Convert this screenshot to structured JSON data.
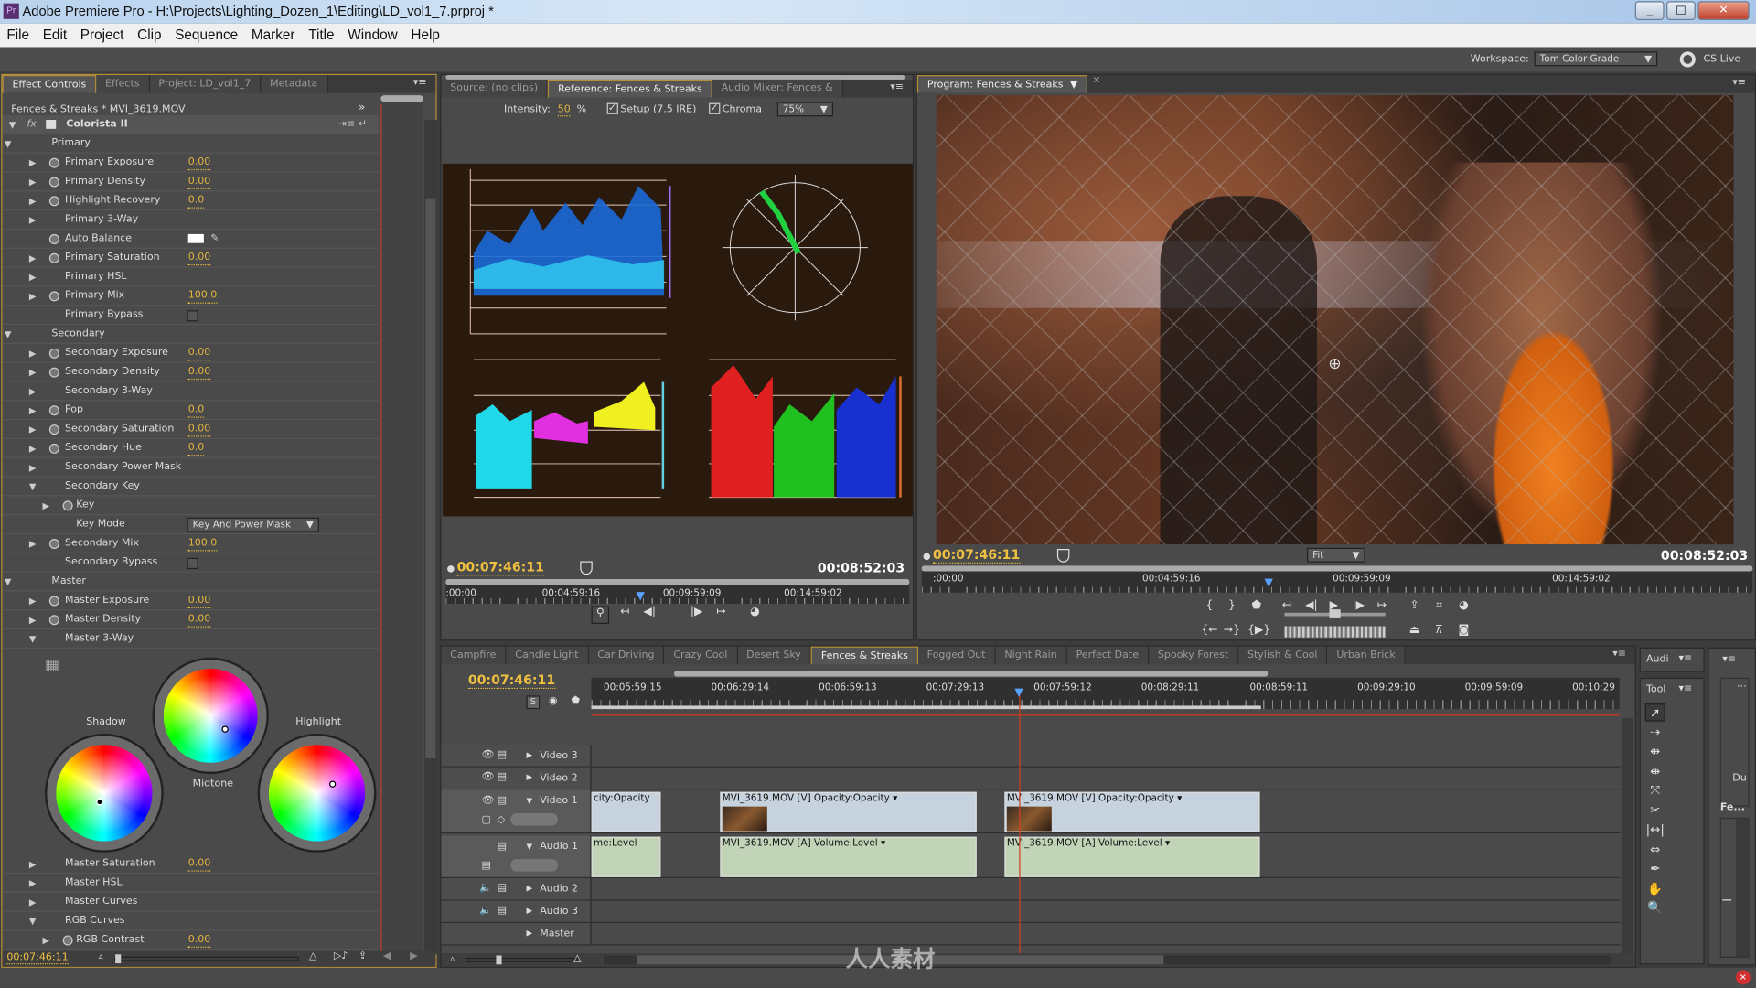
{
  "window": {
    "title": "Adobe Premiere Pro - H:\\Projects\\Lighting_Dozen_1\\Editing\\LD_vol1_7.prproj *",
    "app_icon": "Pr"
  },
  "menu": [
    "File",
    "Edit",
    "Project",
    "Clip",
    "Sequence",
    "Marker",
    "Title",
    "Window",
    "Help"
  ],
  "workspace": {
    "label": "Workspace:",
    "value": "Tom Color Grade",
    "cs_live": "CS Live"
  },
  "effect_controls": {
    "tabs": [
      "Effect Controls",
      "Effects",
      "Project: LD_vol1_7",
      "Metadata"
    ],
    "clip_header": "Fences & Streaks * MVI_3619.MOV",
    "effect_name": "Colorista II",
    "rows_top": [
      {
        "label": "Primary",
        "level": 0,
        "twirl": "open"
      },
      {
        "label": "Primary Exposure",
        "level": 1,
        "twirl": "closed",
        "sw": true,
        "value": "0.00"
      },
      {
        "label": "Primary Density",
        "level": 1,
        "twirl": "closed",
        "sw": true,
        "value": "0.00"
      },
      {
        "label": "Highlight Recovery",
        "level": 1,
        "twirl": "closed",
        "sw": true,
        "value": "0.0"
      },
      {
        "label": "Primary 3-Way",
        "level": 1,
        "twirl": "closed"
      },
      {
        "label": "Auto Balance",
        "level": 1,
        "sw": true,
        "kind": "swatch"
      },
      {
        "label": "Primary Saturation",
        "level": 1,
        "twirl": "closed",
        "sw": true,
        "value": "0.00"
      },
      {
        "label": "Primary HSL",
        "level": 1,
        "twirl": "closed"
      },
      {
        "label": "Primary Mix",
        "level": 1,
        "twirl": "closed",
        "sw": true,
        "value": "100.0"
      },
      {
        "label": "Primary Bypass",
        "level": 1,
        "kind": "checkbox"
      },
      {
        "label": "Secondary",
        "level": 0,
        "twirl": "open"
      },
      {
        "label": "Secondary Exposure",
        "level": 1,
        "twirl": "closed",
        "sw": true,
        "value": "0.00"
      },
      {
        "label": "Secondary Density",
        "level": 1,
        "twirl": "closed",
        "sw": true,
        "value": "0.00"
      },
      {
        "label": "Secondary 3-Way",
        "level": 1,
        "twirl": "closed"
      },
      {
        "label": "Pop",
        "level": 1,
        "twirl": "closed",
        "sw": true,
        "value": "0.0"
      },
      {
        "label": "Secondary Saturation",
        "level": 1,
        "twirl": "closed",
        "sw": true,
        "value": "0.00"
      },
      {
        "label": "Secondary Hue",
        "level": 1,
        "twirl": "closed",
        "sw": true,
        "value": "0.0"
      },
      {
        "label": "Secondary Power Mask",
        "level": 1,
        "twirl": "closed"
      },
      {
        "label": "Secondary Key",
        "level": 1,
        "twirl": "open"
      },
      {
        "label": "Key",
        "level": 2,
        "twirl": "closed",
        "sw": true
      },
      {
        "label": "Key Mode",
        "level": 2,
        "kind": "dropdown",
        "value": "Key And Power Mask"
      },
      {
        "label": "Secondary Mix",
        "level": 1,
        "twirl": "closed",
        "sw": true,
        "value": "100.0"
      },
      {
        "label": "Secondary Bypass",
        "level": 1,
        "kind": "checkbox"
      },
      {
        "label": "Master",
        "level": 0,
        "twirl": "open"
      },
      {
        "label": "Master Exposure",
        "level": 1,
        "twirl": "closed",
        "sw": true,
        "value": "0.00"
      },
      {
        "label": "Master Density",
        "level": 1,
        "twirl": "closed",
        "sw": true,
        "value": "0.00"
      },
      {
        "label": "Master 3-Way",
        "level": 1,
        "twirl": "open"
      }
    ],
    "wheels": {
      "shadow": "Shadow",
      "midtone": "Midtone",
      "highlight": "Highlight"
    },
    "rows_bottom": [
      {
        "label": "Master Saturation",
        "level": 1,
        "twirl": "closed",
        "value": "0.00"
      },
      {
        "label": "Master HSL",
        "level": 1,
        "twirl": "closed"
      },
      {
        "label": "Master Curves",
        "level": 1,
        "twirl": "closed"
      },
      {
        "label": "RGB Curves",
        "level": 1,
        "twirl": "open"
      },
      {
        "label": "RGB Contrast",
        "level": 2,
        "twirl": "closed",
        "sw": true,
        "value": "0.00"
      }
    ],
    "timecode": "00:07:46:11"
  },
  "reference": {
    "tabs": [
      "Source: (no clips)",
      "Reference: Fences & Streaks",
      "Audio Mixer: Fences &"
    ],
    "intensity_label": "Intensity:",
    "intensity": "50",
    "pct": "%",
    "setup_label": "Setup (7.5 IRE)",
    "setup_checked": true,
    "chroma_label": "Chroma",
    "chroma_checked": true,
    "zoom": "75%",
    "timecode": "00:07:46:11",
    "duration": "00:08:52:03",
    "ruler": [
      ":00:00",
      "00:04:59:16",
      "00:09:59:09",
      "00:14:59:02"
    ]
  },
  "program": {
    "tab": "Program: Fences & Streaks",
    "timecode": "00:07:46:11",
    "duration": "00:08:52:03",
    "fit": "Fit",
    "ruler": [
      ":00:00",
      "00:04:59:16",
      "00:09:59:09",
      "00:14:59:02"
    ]
  },
  "timeline": {
    "tabs": [
      "Campfire",
      "Candle Light",
      "Car Driving",
      "Crazy Cool",
      "Desert Sky",
      "Fences & Streaks",
      "Fogged Out",
      "Night Rain",
      "Perfect Date",
      "Spooky Forest",
      "Stylish & Cool",
      "Urban Brick"
    ],
    "active_tab": "Fences & Streaks",
    "timecode": "00:07:46:11",
    "ruler": [
      "00:05:59:15",
      "00:06:29:14",
      "00:06:59:13",
      "00:07:29:13",
      "00:07:59:12",
      "00:08:29:11",
      "00:08:59:11",
      "00:09:29:10",
      "00:09:59:09",
      "00:10:29"
    ],
    "tracks": {
      "v3": "Video 3",
      "v2": "Video 2",
      "v1": "Video 1",
      "a1": "Audio 1",
      "a2": "Audio 2",
      "a3": "Audio 3",
      "master": "Master"
    },
    "clips": {
      "v_prev": "city:Opacity",
      "a_prev": "me:Level",
      "v1": "MVI_3619.MOV [V]",
      "v1_fx": "Opacity:Opacity",
      "a1": "MVI_3619.MOV [A]",
      "a1_fx": "Volume:Level",
      "v2": "MVI_3619.MOV [V]",
      "v2_fx": "Opacity:Opacity",
      "a2": "MVI_3619.MOV [A]",
      "a2_fx": "Volume:Level"
    }
  },
  "side": {
    "audio_tab": "Audi",
    "tools_tab": "Tool",
    "du": "Du",
    "fe": "Fe...",
    "dots": "..."
  },
  "tools": [
    "selection-tool",
    "track-select-tool",
    "ripple-edit-tool",
    "rolling-edit-tool",
    "rate-stretch-tool",
    "razor-tool",
    "slip-tool",
    "slide-tool",
    "pen-tool",
    "hand-tool",
    "zoom-tool"
  ],
  "watermark": "人人素材",
  "colors": {
    "accent": "#f0c040",
    "panel": "#4a4a4a",
    "active_border": "#b58f3a",
    "playhead": "#d04020"
  }
}
